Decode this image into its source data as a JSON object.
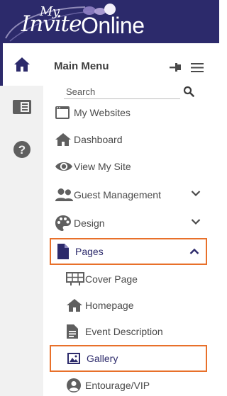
{
  "brand": {
    "logo_my": "My",
    "logo_invite": "Invite",
    "logo_online": "Online",
    "color_header": "#2c2a6b",
    "color_highlight": "#e8702a"
  },
  "rail": [
    {
      "icon": "home-icon",
      "active": true
    },
    {
      "icon": "page-layout-icon",
      "active": false
    },
    {
      "icon": "help-icon",
      "active": false
    }
  ],
  "menu": {
    "title": "Main Menu",
    "search_placeholder": "Search",
    "items": [
      {
        "label": "My Websites",
        "icon": "browser-window-icon"
      },
      {
        "label": "Dashboard",
        "icon": "home-icon"
      },
      {
        "label": "View My Site",
        "icon": "eye-icon"
      },
      {
        "label": "Guest Management",
        "icon": "group-icon",
        "chevron": "down"
      },
      {
        "label": "Design",
        "icon": "palette-icon",
        "chevron": "down"
      },
      {
        "label": "Pages",
        "icon": "document-icon",
        "chevron": "up",
        "selected": true
      }
    ],
    "sub_items": [
      {
        "label": "Cover Page",
        "icon": "billboard-icon"
      },
      {
        "label": "Homepage",
        "icon": "home-icon"
      },
      {
        "label": "Event Description",
        "icon": "text-document-icon"
      },
      {
        "label": "Gallery",
        "icon": "image-icon",
        "selected": true
      },
      {
        "label": "Entourage/VIP",
        "icon": "user-circle-icon"
      }
    ]
  }
}
